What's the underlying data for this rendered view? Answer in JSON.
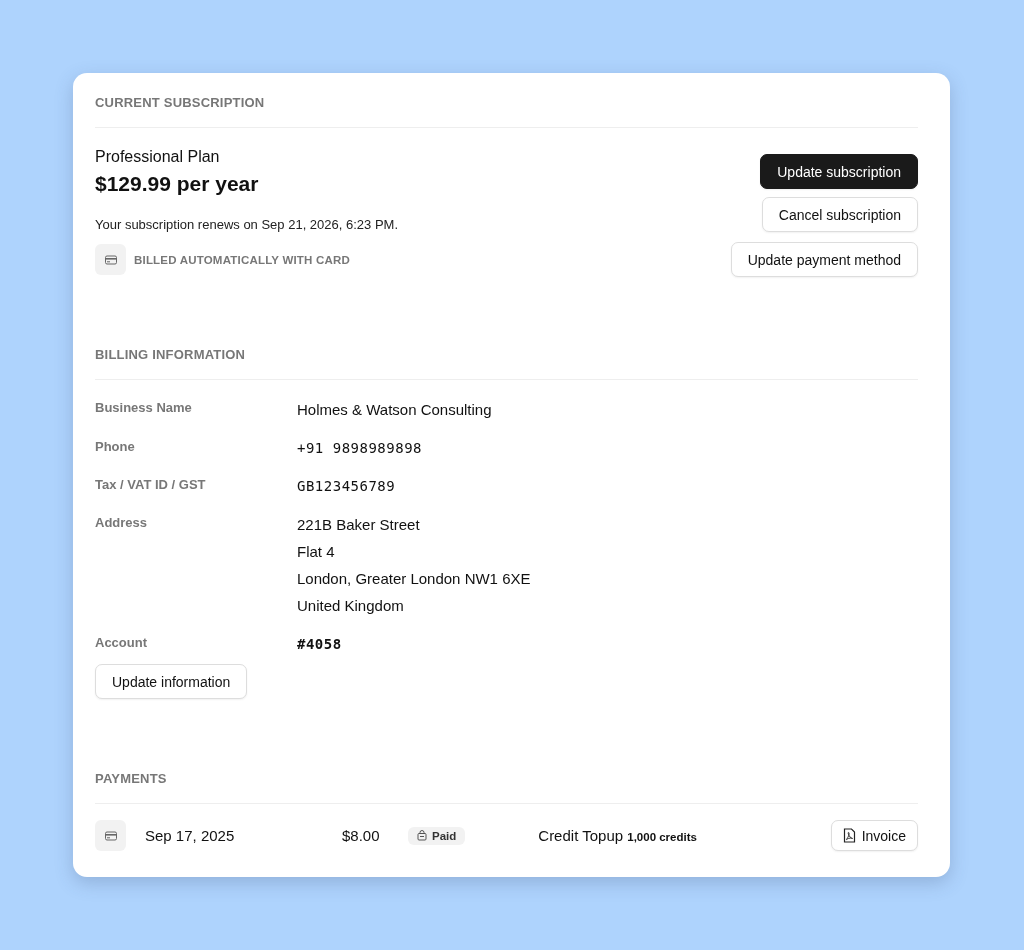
{
  "subscription": {
    "heading": "CURRENT SUBSCRIPTION",
    "plan": "Professional Plan",
    "price": "$129.99 per year",
    "renewal": "Your subscription renews on Sep 21, 2026, 6:23 PM.",
    "billing_method": "BILLED AUTOMATICALLY WITH CARD",
    "buttons": [
      {
        "label": "Update subscription",
        "kind": "primary"
      },
      {
        "label": "Cancel subscription",
        "kind": "secondary"
      }
    ],
    "payment_button": "Update payment method"
  },
  "billing": {
    "heading": "BILLING INFORMATION",
    "fields": [
      {
        "label": "Business Name",
        "kind": "text",
        "lines": [
          "Holmes & Watson Consulting"
        ]
      },
      {
        "label": "Phone",
        "kind": "mono",
        "lines": [
          "+91 9898989898"
        ]
      },
      {
        "label": "Tax / VAT ID / GST",
        "kind": "mono",
        "lines": [
          "GB123456789"
        ]
      },
      {
        "label": "Address",
        "kind": "text",
        "lines": [
          "221B Baker Street",
          "Flat 4",
          "London, Greater London NW1 6XE",
          "United Kingdom"
        ]
      },
      {
        "label": "Account",
        "kind": "mono-bold",
        "lines": [
          "#4058"
        ]
      }
    ],
    "button": "Update information"
  },
  "payments": {
    "heading": "PAYMENTS",
    "rows": [
      {
        "date": "Sep 17, 2025",
        "amount": "$8.00",
        "status": "Paid",
        "description": "Credit Topup",
        "detail": "1,000 credits",
        "action": "Invoice"
      }
    ]
  }
}
